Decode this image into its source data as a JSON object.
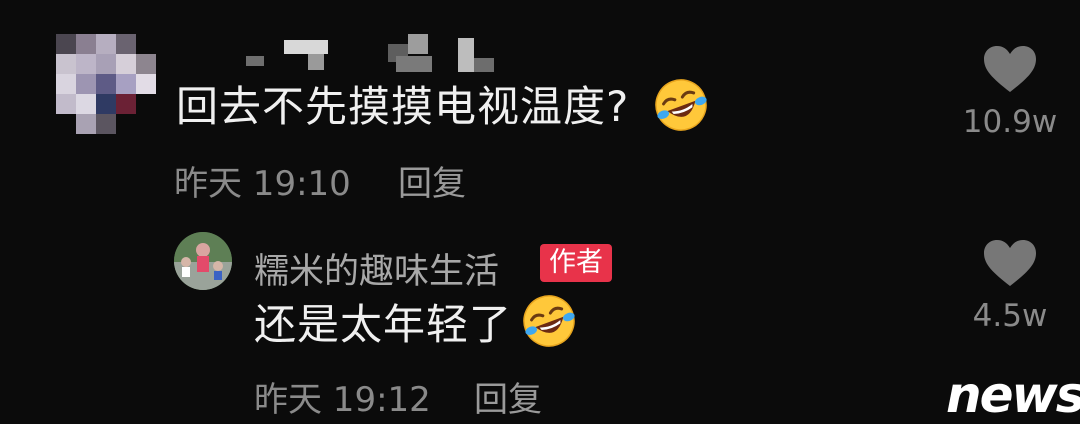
{
  "comments": [
    {
      "text": "回去不先摸摸电视温度?",
      "emoji_icon": "rofl-emoji",
      "time": "昨天 19:10",
      "reply_label": "回复",
      "likes": "10.9w"
    }
  ],
  "reply_comment": {
    "author": "糯米的趣味生活",
    "author_badge": "作者",
    "text": "还是太年轻了",
    "emoji_icon": "rofl-emoji",
    "time": "昨天 19:12",
    "reply_label": "回复",
    "likes": "4.5w"
  },
  "watermark": "news",
  "colors": {
    "background": "#0b0b0b",
    "badge": "#e8334a",
    "emoji_face": "#ffc83a"
  }
}
